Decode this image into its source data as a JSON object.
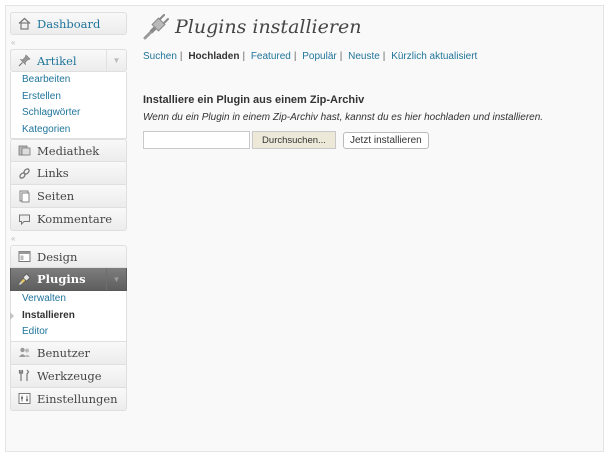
{
  "sidebar": {
    "dashboard": {
      "label": "Dashboard",
      "icon": "home-icon"
    },
    "artikel": {
      "label": "Artikel",
      "icon": "pushpin-icon",
      "items": [
        {
          "label": "Bearbeiten"
        },
        {
          "label": "Erstellen"
        },
        {
          "label": "Schlagwörter"
        },
        {
          "label": "Kategorien"
        }
      ]
    },
    "mediathek": {
      "label": "Mediathek",
      "icon": "media-icon"
    },
    "links": {
      "label": "Links",
      "icon": "link-icon"
    },
    "seiten": {
      "label": "Seiten",
      "icon": "page-icon"
    },
    "kommentare": {
      "label": "Kommentare",
      "icon": "comment-icon"
    },
    "design": {
      "label": "Design",
      "icon": "design-icon"
    },
    "plugins": {
      "label": "Plugins",
      "icon": "plug-icon",
      "items": [
        {
          "label": "Verwalten",
          "current": false
        },
        {
          "label": "Installieren",
          "current": true
        },
        {
          "label": "Editor",
          "current": false
        }
      ]
    },
    "benutzer": {
      "label": "Benutzer",
      "icon": "users-icon"
    },
    "werkzeuge": {
      "label": "Werkzeuge",
      "icon": "tools-icon"
    },
    "einstellungen": {
      "label": "Einstellungen",
      "icon": "settings-icon"
    }
  },
  "page": {
    "title": "Plugins installieren",
    "icon": "plugin-icon",
    "subnav": [
      {
        "label": "Suchen",
        "current": false
      },
      {
        "label": "Hochladen",
        "current": true
      },
      {
        "label": "Featured",
        "current": false
      },
      {
        "label": "Populär",
        "current": false
      },
      {
        "label": "Neuste",
        "current": false
      },
      {
        "label": "Kürzlich aktualisiert",
        "current": false
      }
    ],
    "upload": {
      "heading": "Installiere ein Plugin aus einem Zip-Archiv",
      "description": "Wenn du ein Plugin in einem Zip-Archiv hast, kannst du es hier hochladen und installieren.",
      "file_value": "",
      "browse_label": "Durchsuchen...",
      "install_label": "Jetzt installieren"
    }
  },
  "colors": {
    "link": "#21759b",
    "active_menu": "#6d6d6d",
    "background": "#f9f9f9"
  }
}
